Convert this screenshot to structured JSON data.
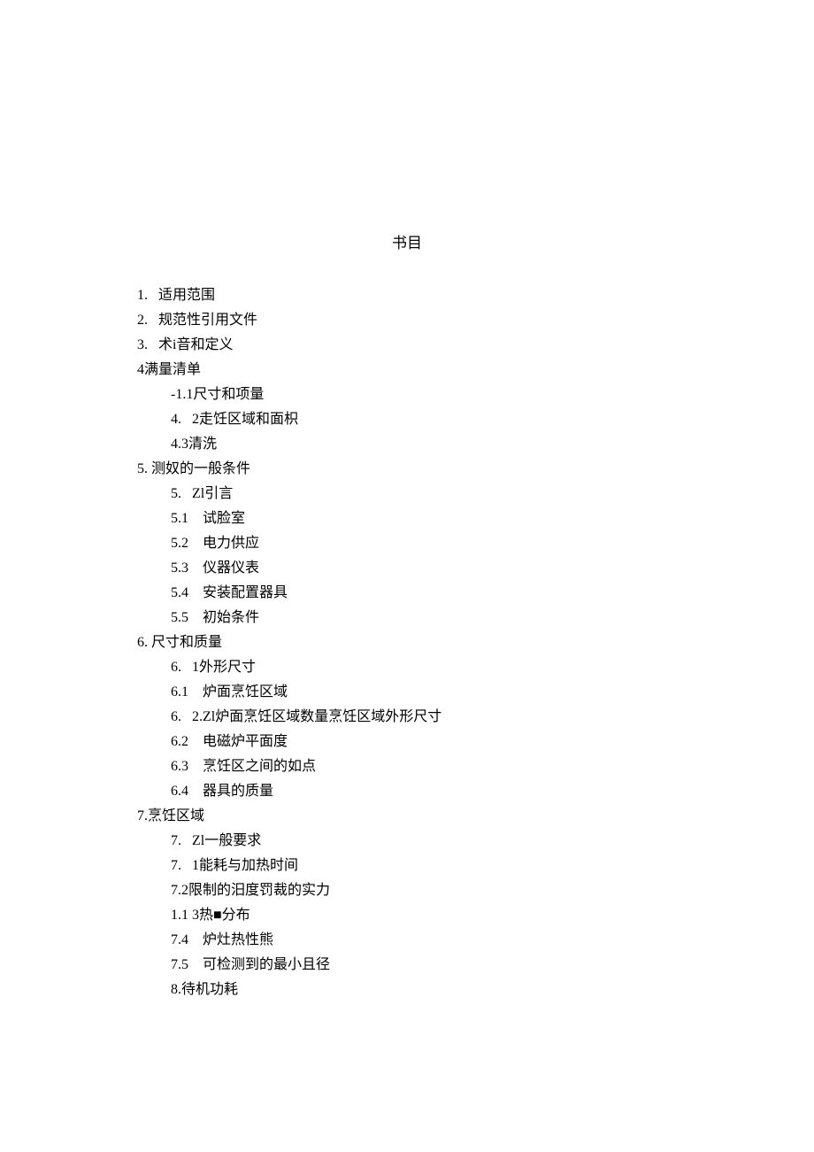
{
  "title": "书目",
  "lines": [
    {
      "indent": 0,
      "text": "1.   适用范围"
    },
    {
      "indent": 0,
      "text": "2.   规范性引用文件"
    },
    {
      "indent": 0,
      "text": "3.   术i音和定义"
    },
    {
      "indent": 0,
      "text": "4满量清单"
    },
    {
      "indent": 1,
      "text": "-1.1尺寸和项量"
    },
    {
      "indent": 1,
      "text": "4.   2走饪区域和面枳"
    },
    {
      "indent": 1,
      "text": "4.3清洗"
    },
    {
      "indent": 0,
      "text": "5. 测奴的一般条件"
    },
    {
      "indent": 1,
      "text": "5.   Zl引言"
    },
    {
      "indent": 1,
      "text": "5.1    试脸室"
    },
    {
      "indent": 1,
      "text": "5.2    电力供应"
    },
    {
      "indent": 1,
      "text": "5.3    仪器仪表"
    },
    {
      "indent": 1,
      "text": "5.4    安装配置器具"
    },
    {
      "indent": 1,
      "text": "5.5    初始条件"
    },
    {
      "indent": 0,
      "text": "6. 尺寸和质量"
    },
    {
      "indent": 1,
      "text": "6.   1外形尺寸"
    },
    {
      "indent": 1,
      "text": "6.1    炉面烹饪区域"
    },
    {
      "indent": 1,
      "text": "6.   2.Zl炉面烹饪区域数量烹饪区域外形尺寸"
    },
    {
      "indent": 1,
      "text": "6.2    电磁炉平面度"
    },
    {
      "indent": 1,
      "text": "6.3    烹饪区之间的如点"
    },
    {
      "indent": 1,
      "text": "6.4    器具的质量"
    },
    {
      "indent": 0,
      "text": "7.烹饪区域"
    },
    {
      "indent": 1,
      "text": "7.   Zl一般要求"
    },
    {
      "indent": 1,
      "text": "7.   1能耗与加热时间"
    },
    {
      "indent": 1,
      "text": "7.2限制的汨度罚裁的实力"
    },
    {
      "indent": 1,
      "text": "1.1 3热■分布"
    },
    {
      "indent": 1,
      "text": "7.4    炉灶热性熊"
    },
    {
      "indent": 1,
      "text": "7.5    可检测到的最小且径"
    },
    {
      "indent": 1,
      "text": "8.待机功耗"
    }
  ]
}
